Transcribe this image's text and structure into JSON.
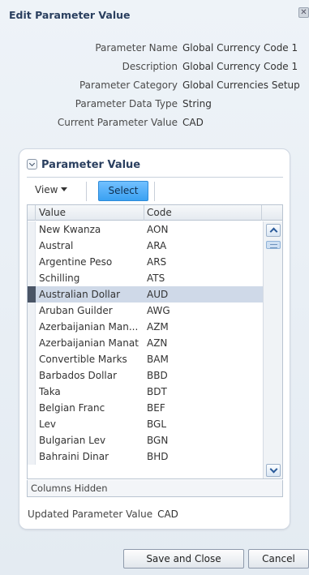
{
  "dialog": {
    "title": "Edit Parameter Value",
    "close_icon": "close-icon"
  },
  "info": [
    {
      "label": "Parameter Name",
      "value": "Global Currency Code 1"
    },
    {
      "label": "Description",
      "value": "Global Currency Code 1"
    },
    {
      "label": "Parameter Category",
      "value": "Global Currencies Setup"
    },
    {
      "label": "Parameter Data Type",
      "value": "String"
    },
    {
      "label": "Current Parameter Value",
      "value": "CAD"
    }
  ],
  "panel": {
    "title": "Parameter Value",
    "toolbar": {
      "view_label": "View",
      "select_label": "Select"
    },
    "table": {
      "columns": [
        "Value",
        "Code"
      ],
      "rows": [
        {
          "value": "New Kwanza",
          "code": "AON",
          "selected": false
        },
        {
          "value": "Austral",
          "code": "ARA",
          "selected": false
        },
        {
          "value": "Argentine Peso",
          "code": "ARS",
          "selected": false
        },
        {
          "value": "Schilling",
          "code": "ATS",
          "selected": false
        },
        {
          "value": "Australian Dollar",
          "code": "AUD",
          "selected": true
        },
        {
          "value": "Aruban Guilder",
          "code": "AWG",
          "selected": false
        },
        {
          "value": "Azerbaijanian Man...",
          "code": "AZM",
          "selected": false
        },
        {
          "value": "Azerbaijanian Manat",
          "code": "AZN",
          "selected": false
        },
        {
          "value": "Convertible Marks",
          "code": "BAM",
          "selected": false
        },
        {
          "value": "Barbados Dollar",
          "code": "BBD",
          "selected": false
        },
        {
          "value": "Taka",
          "code": "BDT",
          "selected": false
        },
        {
          "value": "Belgian Franc",
          "code": "BEF",
          "selected": false
        },
        {
          "value": "Lev",
          "code": "BGL",
          "selected": false
        },
        {
          "value": "Bulgarian Lev",
          "code": "BGN",
          "selected": false
        },
        {
          "value": "Bahraini Dinar",
          "code": "BHD",
          "selected": false
        }
      ]
    },
    "status": "Columns Hidden",
    "updated_label": "Updated Parameter Value",
    "updated_value": "CAD"
  },
  "footer": {
    "save_label": "Save and Close",
    "cancel_label": "Cancel"
  },
  "colors": {
    "select_button": "#3aa1f2",
    "selected_row": "#cfd9e8",
    "title": "#2a3f5f"
  }
}
